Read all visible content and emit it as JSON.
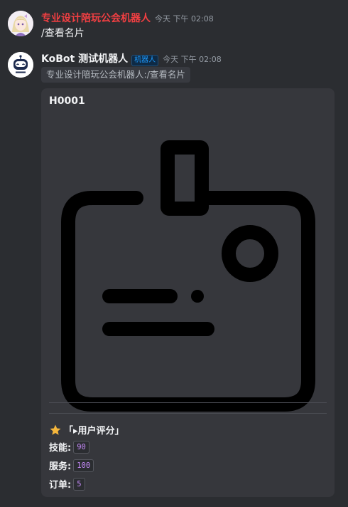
{
  "messages": [
    {
      "username": "专业设计陪玩公会机器人",
      "username_color": "#f23f42",
      "timestamp": "今天 下午 02:08",
      "text": "/查看名片",
      "avatar_icon": "anime-girl-avatar"
    },
    {
      "username": "KoBot 测试机器人",
      "bot_tag": "机器人",
      "timestamp": "今天 下午 02:08",
      "reply_reference": "专业设计陪玩公会机器人:/查看名片",
      "avatar_icon": "robot-avatar",
      "card": {
        "title": "H0001",
        "image_icon": "id-card-icon",
        "section_title": "「▸用户评分」",
        "section_icon": "star-icon",
        "stats": [
          {
            "label": "技能:",
            "value": "90"
          },
          {
            "label": "服务:",
            "value": "100"
          },
          {
            "label": "订单:",
            "value": "5"
          }
        ]
      }
    }
  ],
  "colors": {
    "background": "#2b2d31",
    "card": "#36373c",
    "bot_tag": "#1e9bff",
    "badge_text": "#c58af9"
  }
}
